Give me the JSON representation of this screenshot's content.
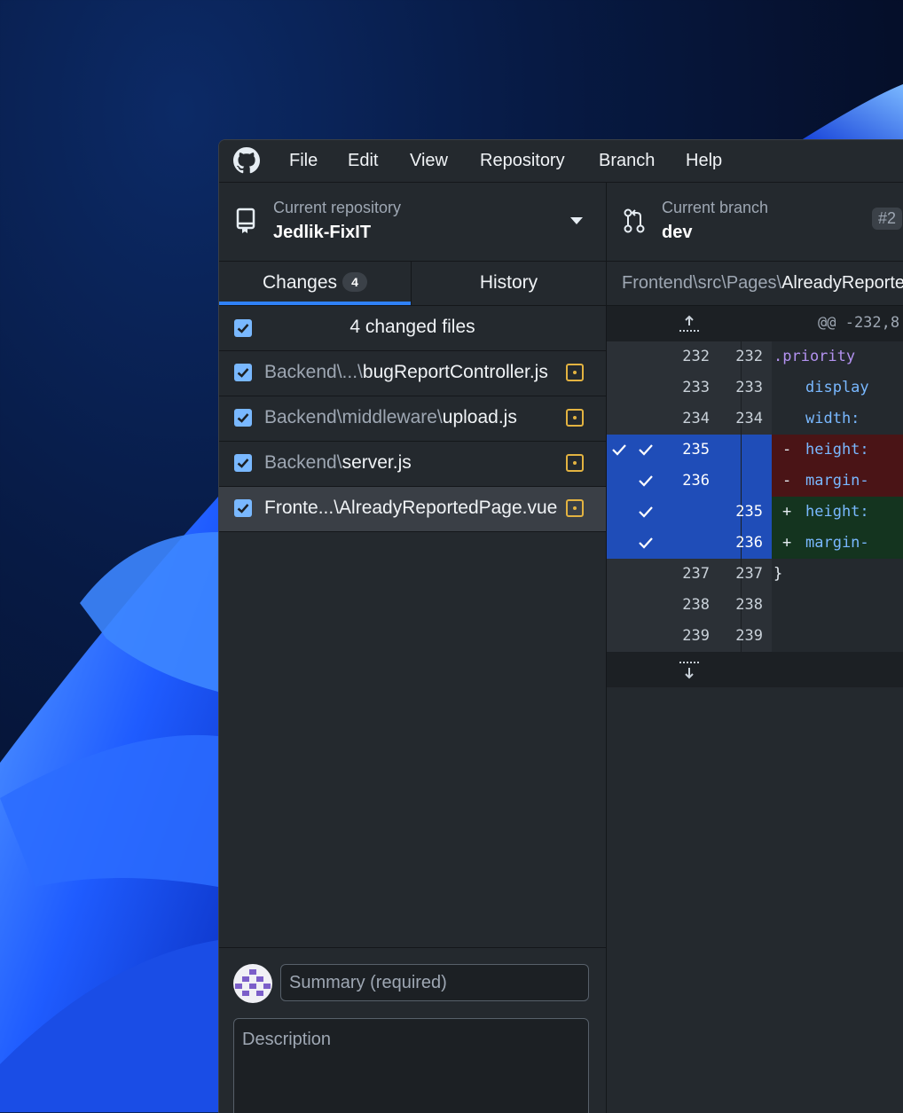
{
  "menu": [
    "File",
    "Edit",
    "View",
    "Repository",
    "Branch",
    "Help"
  ],
  "repo": {
    "label": "Current repository",
    "name": "Jedlik-FixIT"
  },
  "branch": {
    "label": "Current branch",
    "name": "dev",
    "pr": "#2"
  },
  "tabs": {
    "changes": "Changes",
    "changes_count": "4",
    "history": "History"
  },
  "files_header": "4 changed files",
  "files": [
    {
      "dir": "Backend\\...\\",
      "name": "bugReportController.js"
    },
    {
      "dir": "Backend\\middleware\\",
      "name": "upload.js"
    },
    {
      "dir": "Backend\\",
      "name": "server.js"
    },
    {
      "dir": "Fronte...\\",
      "name": "AlreadyReportedPage.vue"
    }
  ],
  "commit": {
    "summary_placeholder": "Summary (required)",
    "description_placeholder": "Description"
  },
  "diff": {
    "path_dir": "Frontend\\src\\Pages\\",
    "path_file": "AlreadyReportedPage.vue",
    "hunk": "@@ -232,8",
    "lines": [
      {
        "old": "232",
        "new": "232",
        "text": ".priority"
      },
      {
        "old": "233",
        "new": "233",
        "text": "display"
      },
      {
        "old": "234",
        "new": "234",
        "text": "width:"
      },
      {
        "old": "235",
        "new": "",
        "sign": "-",
        "text": "height:"
      },
      {
        "old": "236",
        "new": "",
        "sign": "-",
        "text": "margin-"
      },
      {
        "old": "",
        "new": "235",
        "sign": "+",
        "text": "height:"
      },
      {
        "old": "",
        "new": "236",
        "sign": "+",
        "text": "margin-"
      },
      {
        "old": "237",
        "new": "237",
        "text": "}"
      },
      {
        "old": "238",
        "new": "238",
        "text": ""
      },
      {
        "old": "239",
        "new": "239",
        "text": ""
      }
    ]
  }
}
